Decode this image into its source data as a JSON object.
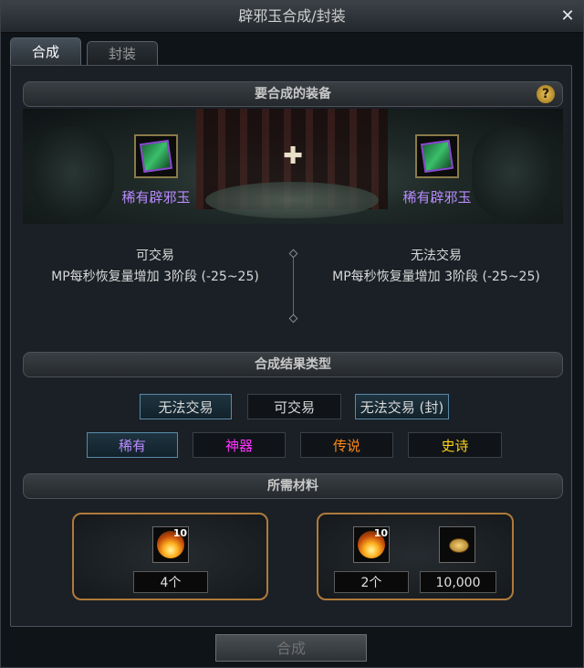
{
  "window": {
    "title": "辟邪玉合成/封装",
    "close_glyph": "✕"
  },
  "tabs": [
    {
      "label": "合成",
      "active": true
    },
    {
      "label": "封装",
      "active": false
    }
  ],
  "equip_section": {
    "title": "要合成的装备",
    "help": "?"
  },
  "items": [
    {
      "name": "稀有辟邪玉",
      "trade": "可交易",
      "effect": "MP每秒恢复量增加 3阶段 (-25~25)"
    },
    {
      "name": "稀有辟邪玉",
      "trade": "无法交易",
      "effect": "MP每秒恢复量增加 3阶段 (-25~25)"
    }
  ],
  "plus_glyph": "✚",
  "result_section": {
    "title": "合成结果类型"
  },
  "trade_options": [
    {
      "label": "无法交易",
      "selected": true
    },
    {
      "label": "可交易",
      "selected": false
    },
    {
      "label": "无法交易 (封)",
      "selected": true
    }
  ],
  "rarity_options": [
    {
      "label": "稀有",
      "color": "#b98bff",
      "selected": true
    },
    {
      "label": "神器",
      "color": "#ff33ff",
      "selected": false
    },
    {
      "label": "传说",
      "color": "#ff8a1a",
      "selected": false
    },
    {
      "label": "史诗",
      "color": "#ffd21a",
      "selected": false
    }
  ],
  "materials_section": {
    "title": "所需材料"
  },
  "material_sets": [
    {
      "icon": "fire-orb-icon",
      "badge": "10",
      "count": "4个"
    },
    {
      "icon": "fire-orb-icon",
      "badge": "10",
      "count": "2个",
      "gold_icon": "gold-coin-icon",
      "gold": "10,000"
    }
  ],
  "action": {
    "label": "合成",
    "enabled": false
  }
}
